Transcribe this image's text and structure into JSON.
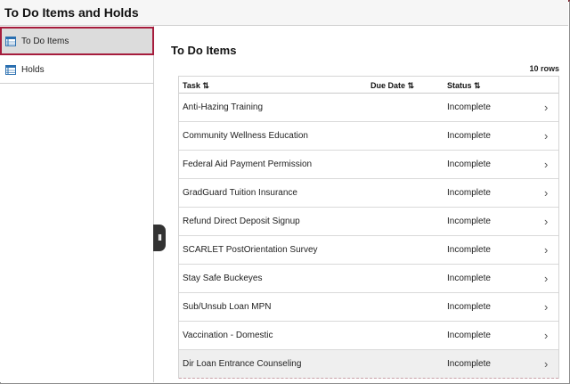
{
  "header": {
    "title": "To Do Items and Holds"
  },
  "sidebar": {
    "items": [
      {
        "label": "To Do Items",
        "icon": "list-icon",
        "active": true
      },
      {
        "label": "Holds",
        "icon": "list-icon",
        "active": false
      }
    ]
  },
  "main": {
    "title": "To Do Items",
    "row_count": "10 rows",
    "columns": {
      "task": "Task ⇅",
      "due_date": "Due Date ⇅",
      "status": "Status ⇅"
    },
    "rows": [
      {
        "task": "Anti-Hazing Training",
        "due_date": "",
        "status": "Incomplete"
      },
      {
        "task": "Community Wellness Education",
        "due_date": "",
        "status": "Incomplete"
      },
      {
        "task": "Federal Aid Payment Permission",
        "due_date": "",
        "status": "Incomplete"
      },
      {
        "task": "GradGuard Tuition Insurance",
        "due_date": "",
        "status": "Incomplete"
      },
      {
        "task": "Refund Direct Deposit Signup",
        "due_date": "",
        "status": "Incomplete"
      },
      {
        "task": "SCARLET PostOrientation Survey",
        "due_date": "",
        "status": "Incomplete"
      },
      {
        "task": "Stay Safe Buckeyes",
        "due_date": "",
        "status": "Incomplete"
      },
      {
        "task": "Sub/Unsub Loan MPN",
        "due_date": "",
        "status": "Incomplete"
      },
      {
        "task": "Vaccination - Domestic",
        "due_date": "",
        "status": "Incomplete"
      },
      {
        "task": "Dir Loan Entrance Counseling",
        "due_date": "",
        "status": "Incomplete"
      }
    ],
    "chevron": "›"
  },
  "collapse_handle": {
    "glyph": "II"
  },
  "colors": {
    "accent": "#a61c3c",
    "header_border": "#7a1f2b",
    "selected_bg": "#dcdcdc"
  }
}
